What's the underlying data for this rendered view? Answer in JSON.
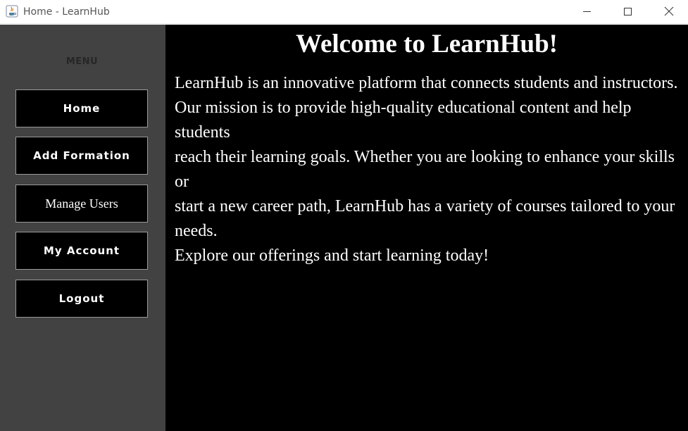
{
  "window": {
    "title": "Home - LearnHub"
  },
  "sidebar": {
    "menu_label": "MENU",
    "items": [
      {
        "label": "Home"
      },
      {
        "label": "Add Formation"
      },
      {
        "label": "Manage Users"
      },
      {
        "label": "My Account"
      },
      {
        "label": "Logout"
      }
    ]
  },
  "main": {
    "title": "Welcome to LearnHub!",
    "paragraphs": [
      "LearnHub is an innovative platform that connects students and instructors.",
      "Our mission is to provide high-quality educational content and help students",
      "reach their learning goals. Whether you are looking to enhance your skills or",
      "start a new career path, LearnHub has a variety of courses tailored to your needs.",
      "Explore our offerings and start learning today!"
    ]
  },
  "colors": {
    "sidebar_bg": "#424242",
    "main_bg": "#000000",
    "button_bg": "#000000",
    "text": "#ffffff"
  }
}
